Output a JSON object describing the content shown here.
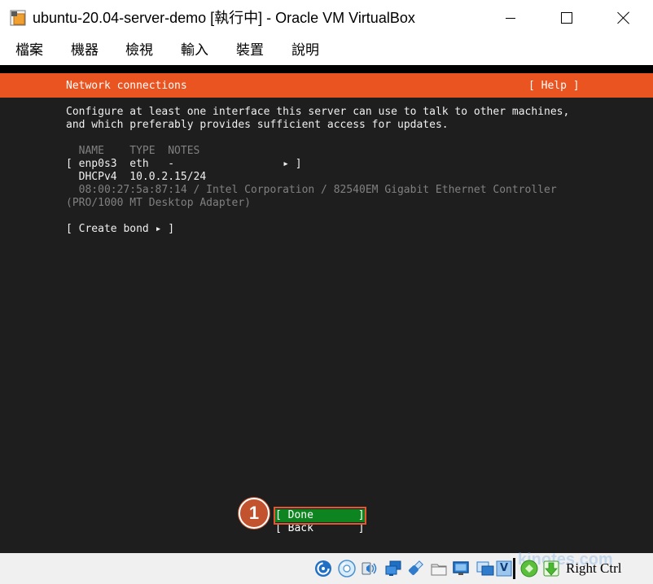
{
  "window": {
    "app_icon": "virtualbox-app-icon",
    "title": "ubuntu-20.04-server-demo [執行中] - Oracle VM VirtualBox",
    "controls": [
      "minimize-icon",
      "maximize-icon",
      "close-icon"
    ]
  },
  "menu": {
    "items": [
      {
        "label": "檔案"
      },
      {
        "label": "機器"
      },
      {
        "label": "檢視"
      },
      {
        "label": "輸入"
      },
      {
        "label": "裝置"
      },
      {
        "label": "說明"
      }
    ]
  },
  "installer": {
    "header_title": "Network connections",
    "help_label": "[ Help ]",
    "intro": [
      "Configure at least one interface this server can use to talk to other machines,",
      "and which preferably provides sufficient access for updates."
    ],
    "columns": {
      "name": "NAME",
      "type": "TYPE",
      "notes": "NOTES"
    },
    "interfaces": [
      {
        "open_bracket": "[",
        "name": "enp0s3",
        "type": "eth",
        "notes": "-",
        "arrow": "▸",
        "close_bracket": "]",
        "addresses": [
          {
            "method": "DHCPv4",
            "address": "10.0.2.15/24"
          }
        ],
        "hardware_info": "08:00:27:5a:87:14 / Intel Corporation / 82540EM Gigabit Ethernet Controller",
        "hardware_info_cont": "(PRO/1000 MT Desktop Adapter)"
      }
    ],
    "create_bond_label": "[ Create bond ▸ ]",
    "buttons": {
      "done_label": "[ Done       ]",
      "back_label": "[ Back       ]"
    }
  },
  "annotation": {
    "step": "1"
  },
  "statusbar": {
    "icons": [
      "hard-disk-icon",
      "optical-drive-icon",
      "audio-icon",
      "network-icon",
      "usb-icon",
      "shared-folders-icon",
      "display-icon",
      "recording-icon",
      "features-icon",
      "mouse-integration-icon",
      "keyboard-capture-icon"
    ],
    "features_badge": "V",
    "host_key": "Right Ctrl"
  },
  "watermark": "kjnotes.com",
  "theme": {
    "header_orange": "#e95420",
    "done_green": "#0e8420",
    "annotation_color": "#c2532e",
    "terminal_bg": "#1e1e1e"
  }
}
